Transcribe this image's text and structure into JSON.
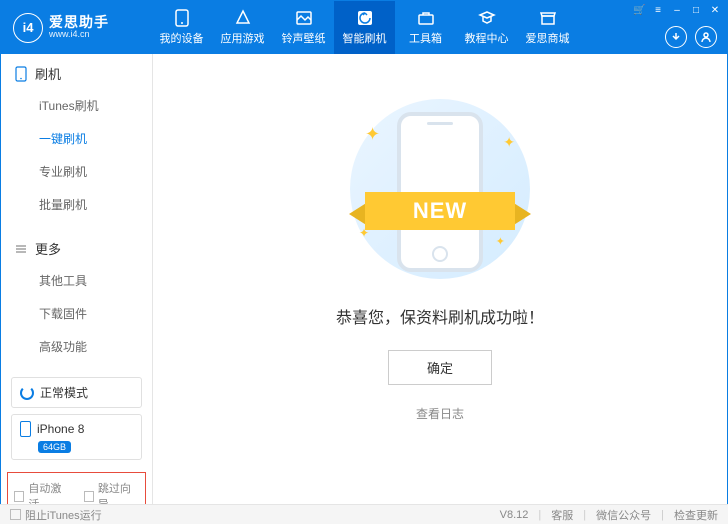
{
  "header": {
    "logo_letters": "i4",
    "logo_title": "爱思助手",
    "logo_url": "www.i4.cn",
    "nav": [
      {
        "label": "我的设备"
      },
      {
        "label": "应用游戏"
      },
      {
        "label": "铃声壁纸"
      },
      {
        "label": "智能刷机"
      },
      {
        "label": "工具箱"
      },
      {
        "label": "教程中心"
      },
      {
        "label": "爱思商城"
      }
    ]
  },
  "sidebar": {
    "section1": {
      "title": "刷机",
      "items": [
        "iTunes刷机",
        "一键刷机",
        "专业刷机",
        "批量刷机"
      ]
    },
    "section2": {
      "title": "更多",
      "items": [
        "其他工具",
        "下载固件",
        "高级功能"
      ]
    },
    "mode": "正常模式",
    "device": {
      "name": "iPhone 8",
      "storage": "64GB"
    },
    "checks": {
      "auto_activate": "自动激活",
      "skip_guide": "跳过向导"
    }
  },
  "main": {
    "ribbon": "NEW",
    "message": "恭喜您，保资料刷机成功啦！",
    "ok": "确定",
    "log": "查看日志"
  },
  "footer": {
    "block_itunes": "阻止iTunes运行",
    "version": "V8.12",
    "links": [
      "客服",
      "微信公众号",
      "检查更新"
    ]
  }
}
